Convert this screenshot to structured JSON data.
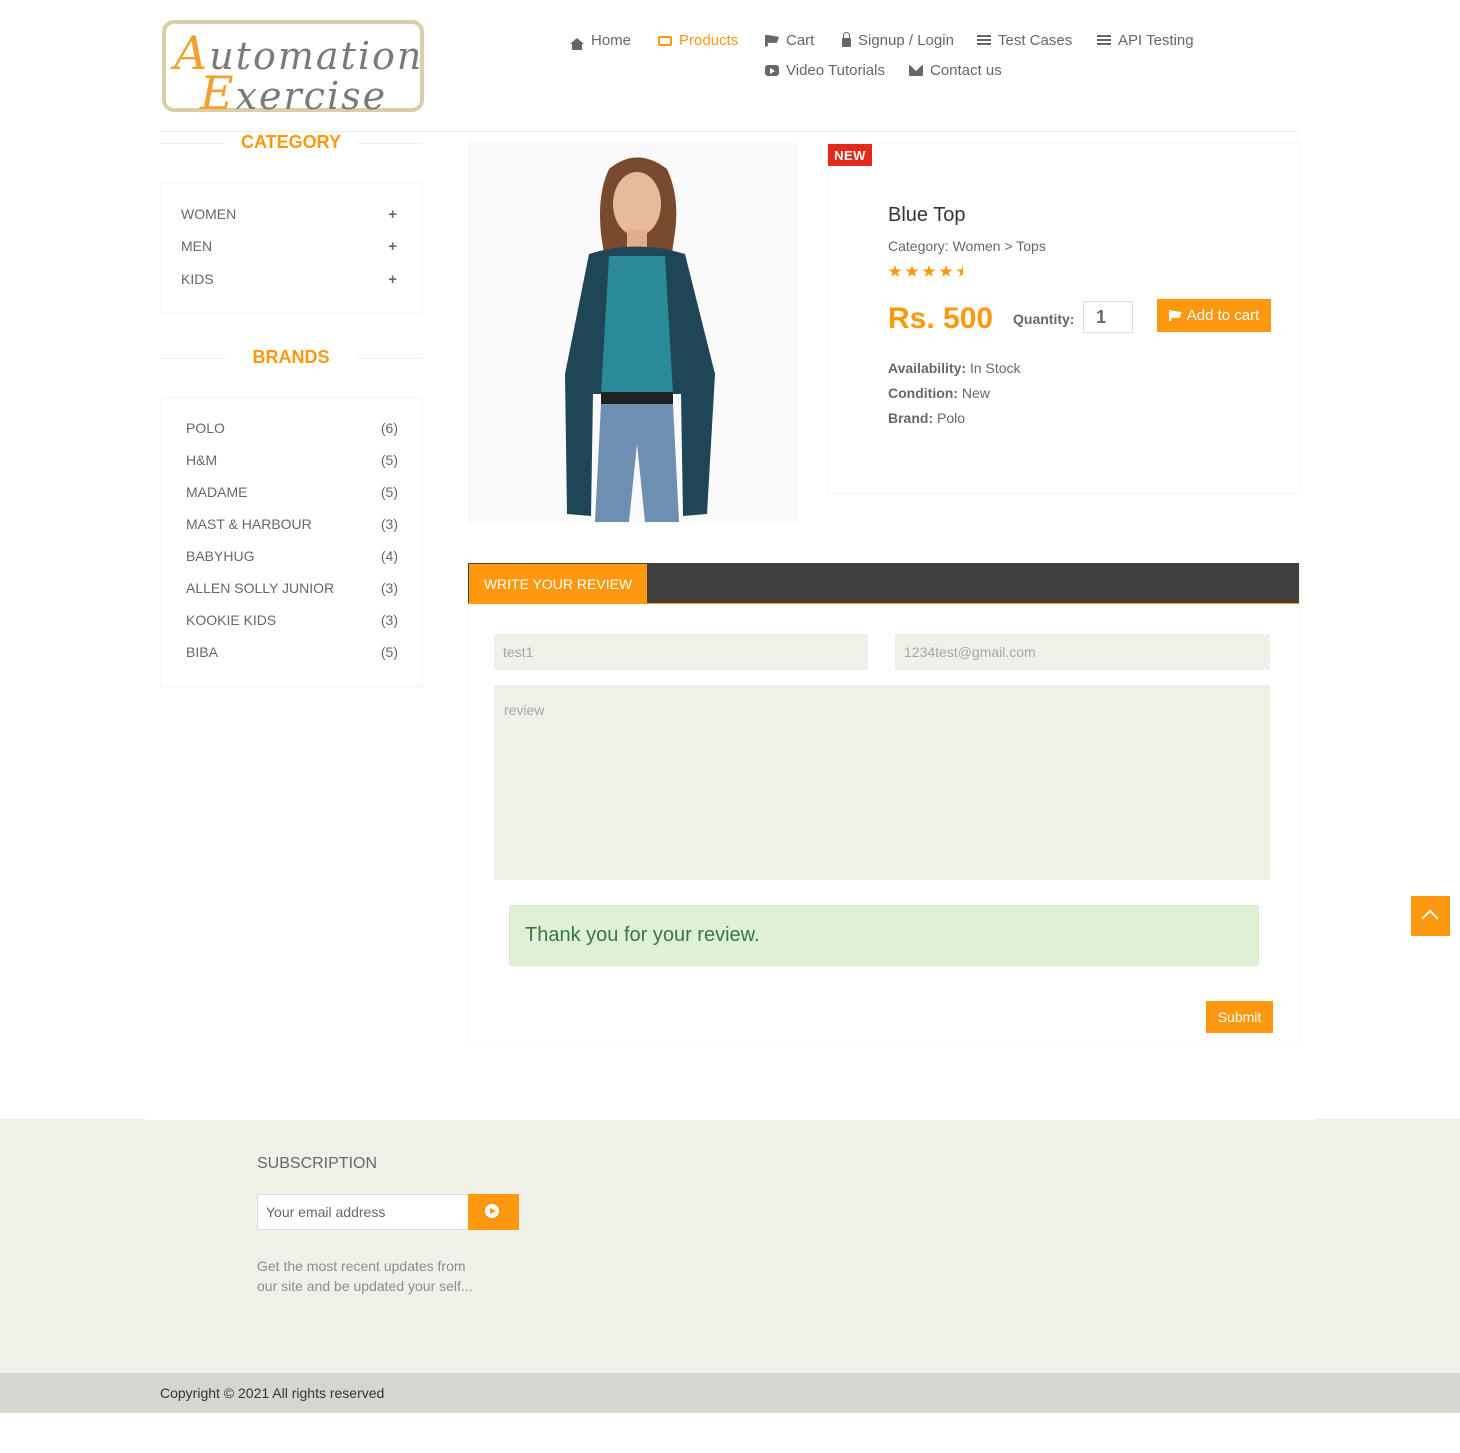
{
  "header": {
    "logo": {
      "line1_cap": "A",
      "line1_rest": "utomation",
      "line2_cap": "E",
      "line2_rest": "xercise"
    },
    "nav": [
      {
        "label": "Home",
        "icon": "home-icon"
      },
      {
        "label": "Products",
        "icon": "product-box-icon",
        "active": true
      },
      {
        "label": "Cart",
        "icon": "cart-icon"
      },
      {
        "label": "Signup / Login",
        "icon": "lock-icon"
      },
      {
        "label": "Test Cases",
        "icon": "list-icon"
      },
      {
        "label": "API Testing",
        "icon": "list-icon"
      },
      {
        "label": "Video Tutorials",
        "icon": "youtube-icon"
      },
      {
        "label": "Contact us",
        "icon": "envelope-icon"
      }
    ]
  },
  "sidebar": {
    "category_title": "Category",
    "categories": [
      {
        "label": "Women",
        "toggle": "+"
      },
      {
        "label": "Men",
        "toggle": "+"
      },
      {
        "label": "Kids",
        "toggle": "+"
      }
    ],
    "brands_title": "Brands",
    "brands": [
      {
        "label": "Polo",
        "count": "(6)"
      },
      {
        "label": "H&M",
        "count": "(5)"
      },
      {
        "label": "Madame",
        "count": "(5)"
      },
      {
        "label": "Mast & Harbour",
        "count": "(3)"
      },
      {
        "label": "Babyhug",
        "count": "(4)"
      },
      {
        "label": "Allen Solly Junior",
        "count": "(3)"
      },
      {
        "label": "Kookie Kids",
        "count": "(3)"
      },
      {
        "label": "Biba",
        "count": "(5)"
      }
    ]
  },
  "product": {
    "badge": "NEW",
    "name": "Blue Top",
    "category": "Category: Women > Tops",
    "rating": 4.5,
    "price": "Rs. 500",
    "quantity_label": "Quantity:",
    "quantity_value": "1",
    "add_to_cart": "Add to cart",
    "availability_label": "Availability:",
    "availability_value": "In Stock",
    "condition_label": "Condition:",
    "condition_value": "New",
    "brand_label": "Brand:",
    "brand_value": "Polo"
  },
  "review": {
    "tab_label": "WRITE YOUR REVIEW",
    "name_value": "test1",
    "email_value": "1234test@gmail.com",
    "review_placeholder": "review",
    "success_message": "Thank you for your review.",
    "submit_label": "Submit"
  },
  "footer": {
    "subscription_title": "Subscription",
    "email_placeholder": "Your email address",
    "description": "Get the most recent updates from our site and be updated your self...",
    "copyright": "Copyright © 2021 All rights reserved"
  },
  "colors": {
    "accent": "#fe980f",
    "badge": "#e32a1b",
    "dark_bar": "#40403e",
    "alert_bg": "#dff0d8",
    "alert_text": "#3c763d"
  }
}
